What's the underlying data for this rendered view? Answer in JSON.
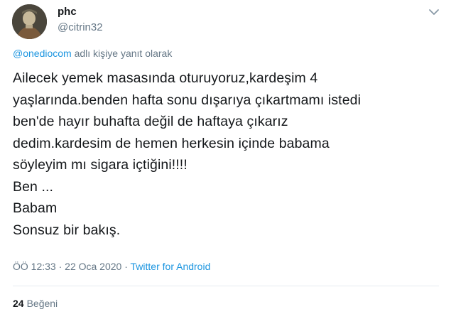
{
  "author": {
    "display_name": "phc",
    "handle": "@citrin32"
  },
  "reply_context": {
    "mention": "@onediocom",
    "suffix": " adlı kişiye yanıt olarak"
  },
  "tweet": {
    "lines": [
      "Ailecek yemek masasında oturuyoruz,kardeşim 4",
      "yaşlarında.benden hafta sonu dışarıya çıkartmamı istedi",
      "ben'de hayır buhafta değil de haftaya çıkarız",
      "dedim.kardesim de hemen herkesin içinde babama",
      "söyleyim mı sigara içtiğini!!!!",
      "Ben ...",
      "Babam",
      "Sonsuz bir bakış."
    ]
  },
  "meta": {
    "time": "ÖÖ 12:33",
    "separator1": " · ",
    "date": "22 Oca 2020",
    "separator2": " · ",
    "source": "Twitter for Android"
  },
  "stats": {
    "likes_count": "24",
    "likes_label": "Beğeni"
  },
  "icons": {
    "caret": "chevron-down-icon",
    "avatar": "avatar"
  }
}
